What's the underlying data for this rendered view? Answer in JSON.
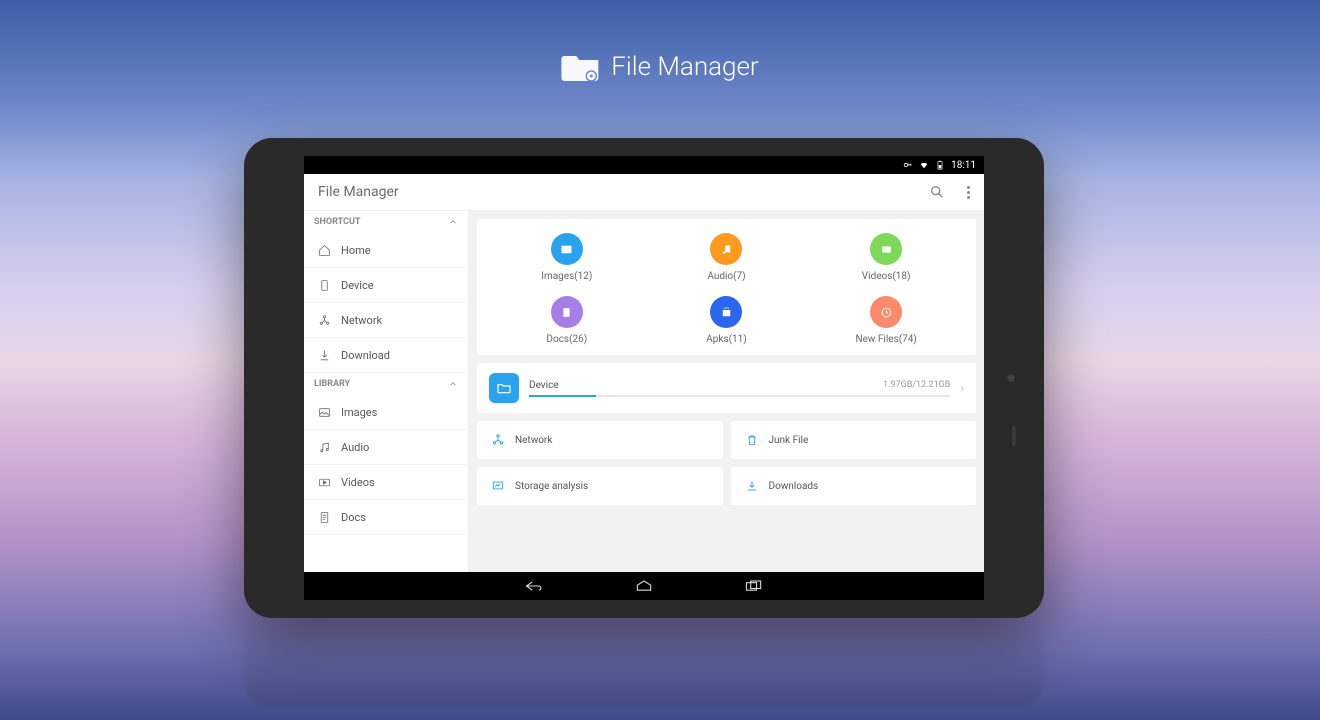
{
  "promo": {
    "title": "File Manager"
  },
  "statusbar": {
    "time": "18:11"
  },
  "appbar": {
    "title": "File Manager"
  },
  "sidebar": {
    "sections": [
      {
        "title": "SHORTCUT",
        "items": [
          "Home",
          "Device",
          "Network",
          "Download"
        ]
      },
      {
        "title": "LIBRARY",
        "items": [
          "Images",
          "Audio",
          "Videos",
          "Docs"
        ]
      }
    ]
  },
  "categories": [
    {
      "label": "Images(12)",
      "color": "#2aa3ef"
    },
    {
      "label": "Audio(7)",
      "color": "#ff9a1f"
    },
    {
      "label": "Videos(18)",
      "color": "#7fd959"
    },
    {
      "label": "Docs(26)",
      "color": "#a67ee6"
    },
    {
      "label": "Apks(11)",
      "color": "#2a66ef"
    },
    {
      "label": "New Files(74)",
      "color": "#ff8a6b"
    }
  ],
  "storage": {
    "name": "Device",
    "size": "1.97GB/12.21GB",
    "percent": 16
  },
  "actions": [
    {
      "label": "Network"
    },
    {
      "label": "Junk File"
    },
    {
      "label": "Storage analysis"
    },
    {
      "label": "Downloads"
    }
  ]
}
